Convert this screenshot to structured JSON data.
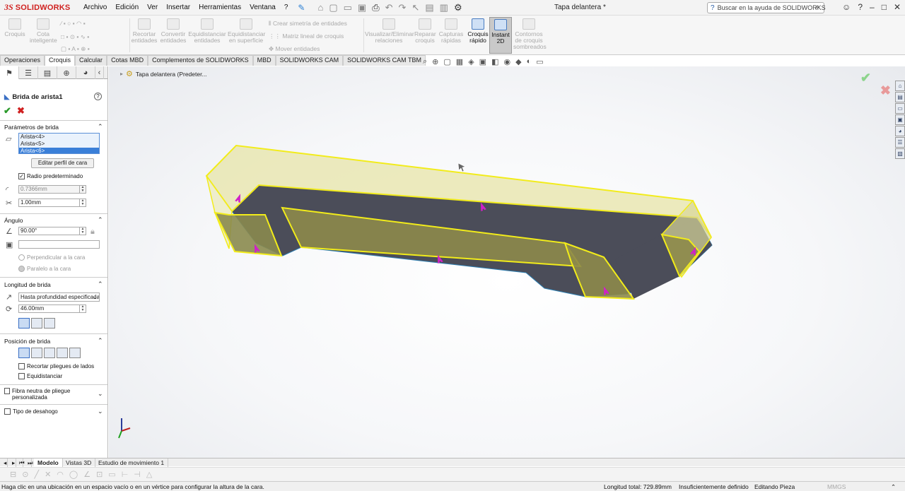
{
  "app": {
    "brand_ds": "3S",
    "brand_name": "SOLIDWORKS",
    "document_title": "Tapa delantera *"
  },
  "menu": [
    "Archivo",
    "Edición",
    "Ver",
    "Insertar",
    "Herramientas",
    "Ventana",
    "?"
  ],
  "search": {
    "placeholder": "Buscar en la ayuda de SOLIDWORKS"
  },
  "ribbon": {
    "croquis": "Croquis",
    "cota_inteligente": "Cota inteligente",
    "recortar": "Recortar entidades",
    "convertir": "Convertir entidades",
    "equidistanciar": "Equidistanciar entidades",
    "equidistanciar_sup": "Equidistanciar en superficie",
    "simetria": "Crear simetría de entidades",
    "matriz": "Matriz lineal de croquis",
    "mover": "Mover entidades",
    "visualizar": "Visualizar/Eliminar relaciones",
    "reparar": "Reparar croquis",
    "capturas": "Capturas rápidas",
    "croquis_rapido": "Croquis rápido",
    "instant2d": "Instant 2D",
    "contornos": "Contornos de croquis sombreados"
  },
  "command_tabs": [
    "Operaciones",
    "Croquis",
    "Calcular",
    "Cotas MBD",
    "Complementos de SOLIDWORKS",
    "MBD",
    "SOLIDWORKS CAM",
    "SOLIDWORKS CAM TBM"
  ],
  "active_command_tab": "Croquis",
  "property_manager": {
    "title": "Brida de arista1",
    "parametros": {
      "title": "Parámetros de brida",
      "edges": [
        "Arista<4>",
        "Arista<5>",
        "Arista<6>"
      ],
      "editar_perfil": "Editar perfil de cara",
      "radio_predeterminado": "Radio predeterminado",
      "radio_value": "0.7366mm",
      "espesor_value": "1.00mm"
    },
    "angulo": {
      "title": "Ángulo",
      "value": "90.00°",
      "perpendicular": "Perpendicular a la cara",
      "paralelo": "Paralelo a la cara"
    },
    "longitud": {
      "title": "Longitud de brida",
      "mode": "Hasta profundidad especificada",
      "value": "46.00mm"
    },
    "posicion": {
      "title": "Posición de brida",
      "recortar": "Recortar pliegues de lados",
      "equidistanciar": "Equidistanciar"
    },
    "fibra_neutra": "Fibra neutra de pliegue personalizada",
    "tipo_desahogo": "Tipo de desahogo"
  },
  "graphics": {
    "tree_label": "Tapa delantera  (Predeter..."
  },
  "bottom_tabs": [
    "Modelo",
    "Vistas 3D",
    "Estudio de movimiento 1"
  ],
  "status": {
    "message": "Haga clic en una ubicación en un espacio vacío o en un vértice para configurar la altura de la cara.",
    "longitud_total": "Longitud total: 729.89mm",
    "definicion": "Insuficientemente definido",
    "editando": "Editando Pieza",
    "units": "MMGS"
  },
  "colors": {
    "brand_red": "#d0211f",
    "flange_yellow": "#f2ec1a",
    "arrow_magenta": "#d020c8",
    "dark_face": "#4a4c58"
  }
}
